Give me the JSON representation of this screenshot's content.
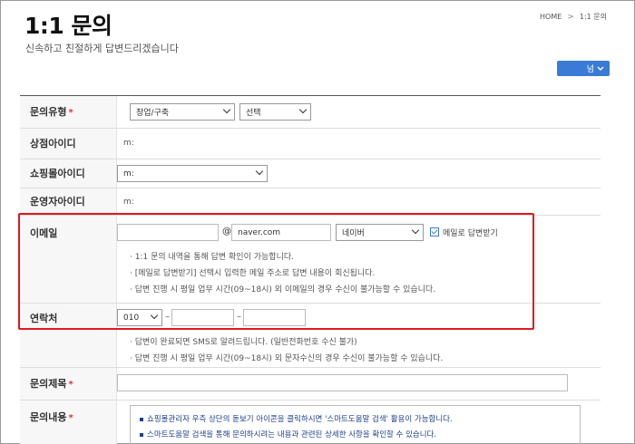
{
  "header": {
    "title": "1:1 문의",
    "subtitle": "신속하고 친절하게 답변드리겠습니다",
    "breadcrumb": [
      "HOME",
      "1:1 문의"
    ],
    "breadcrumb_sep": ">"
  },
  "toolbar": {
    "dropdown_label": "넘",
    "accent": "#3a7bd5"
  },
  "form": {
    "inquiry_type": {
      "label": "문의유형",
      "required": "*",
      "category_value": "창업/구축",
      "sub_value": "선택"
    },
    "store_id": {
      "label": "상점아이디",
      "value": "m:"
    },
    "mall_id": {
      "label": "쇼핑몰아이디",
      "value": "m:"
    },
    "operator_id": {
      "label": "운영자아이디",
      "value": "m:"
    },
    "email": {
      "label": "이메일",
      "local_value": "",
      "at": "@",
      "domain_value": "naver.com",
      "provider_value": "네이버",
      "checkbox_label": "메일로 답변받기",
      "checkbox_checked": true,
      "hints": [
        "· 1:1 문의 내역을 통해 답변 확인이 가능합니다.",
        "· [메일로 답변받기] 선택시 입력한 메일 주소로 답변 내용이 회신됩니다.",
        "· 답변 진행 시 평일 업무 시간(09~18시) 외 이메일의 경우 수신이 불가능할 수 있습니다."
      ]
    },
    "phone": {
      "label": "연락처",
      "prefix_value": "010",
      "dash": "–",
      "middle_value": "",
      "last_value": "",
      "hints": [
        "· 답변이 완료되면 SMS로 알려드립니다. (일반전화번호 수신 불가)",
        "· 답변 진행 시 평일 업무 시간(09~18시) 외 문자수신의 경우 수신이 불가능할 수 있습니다."
      ]
    },
    "subject": {
      "label": "문의제목",
      "required": "*",
      "value": ""
    },
    "content": {
      "label": "문의내용",
      "required": "*",
      "notices": [
        "쇼핑몰관리자 우측 상단의 돋보기 아이콘을 클릭하시면 '스마트도움말 검색' 활용이 가능합니다.",
        "스마트도움말 검색을 통해 문의하시려는 내용과 관련된 상세한 사항을 확인할 수 있습니다."
      ]
    }
  },
  "highlight_color": "#e0191f"
}
